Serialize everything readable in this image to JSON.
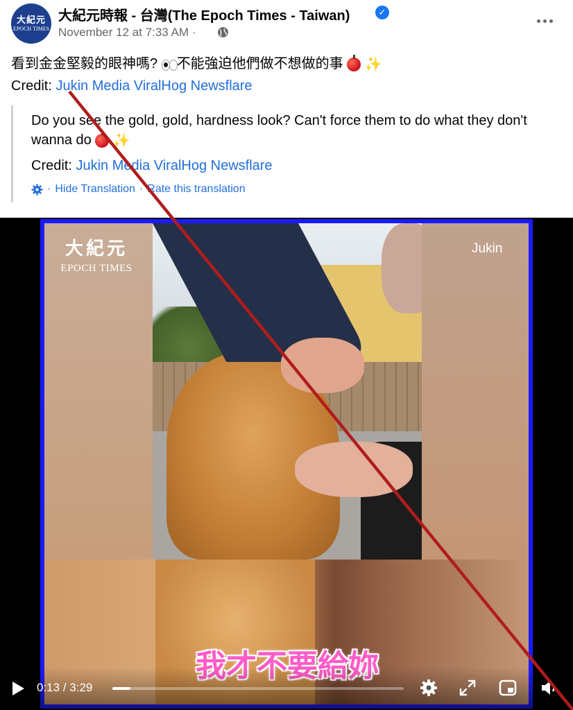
{
  "post": {
    "page_name": "大紀元時報 - 台灣(The Epoch Times - Taiwan)",
    "avatar": {
      "line1": "大紀元",
      "line2": "EPOCH TIMES"
    },
    "timestamp": "November 12 at 7:33 AM",
    "meta_separator": "·",
    "text_part1": "看到金金堅毅的眼神嗎?",
    "text_part2": "不能強迫他們做不想做的事",
    "credit_label": "Credit:",
    "credit_links": "Jukin Media ViralHog Newsflare"
  },
  "translation": {
    "text": "Do you see the gold, gold, hardness look? Can't force them to do what they don't wanna do",
    "credit_label": "Credit:",
    "credit_links": "Jukin Media ViralHog Newsflare",
    "hide_label": "Hide Translation",
    "separator": "·",
    "rate_label": "Rate this translation"
  },
  "video": {
    "logo_cn": "大紀元",
    "logo_en": "EPOCH TIMES",
    "watermark": "Jukin",
    "subtitle": "我才不要給妳",
    "current_time": "0:13",
    "duration": "3:29",
    "time_separator": "/",
    "progress": 0.0622
  },
  "icons": {
    "verified": "verified-badge-icon",
    "globe": "globe-icon",
    "more": "more-options-icon",
    "gear": "settings-gear-icon",
    "play": "play-icon",
    "fullscreen": "fullscreen-icon",
    "pip": "picture-in-picture-icon",
    "volume": "volume-icon"
  },
  "colors": {
    "link": "#216fdb",
    "frame_border": "#1a1aff",
    "strike_line": "#b01c1c",
    "subtitle": "#ff5cc8"
  }
}
